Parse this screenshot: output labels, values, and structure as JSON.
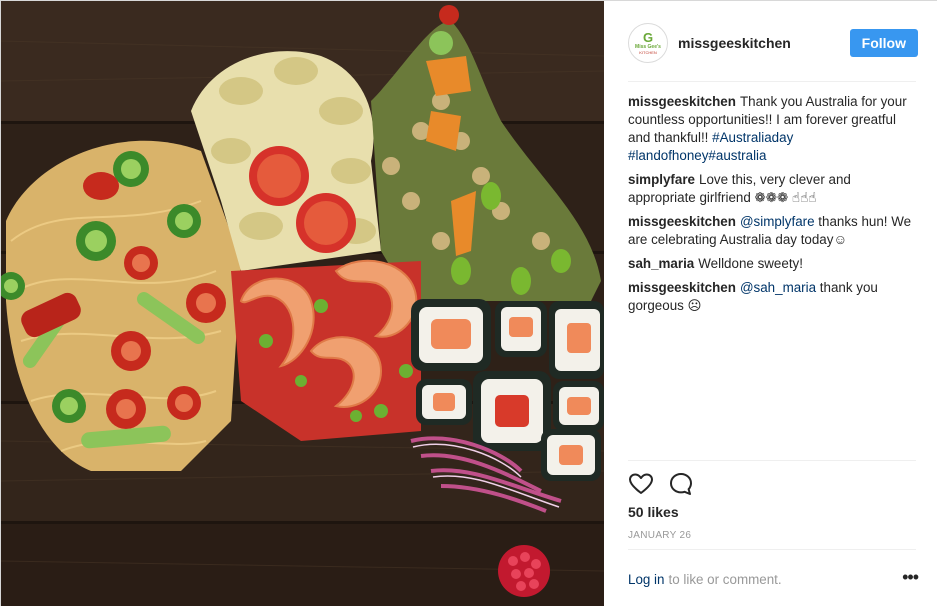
{
  "post": {
    "username": "missgeeskitchen",
    "follow_label": "Follow",
    "avatar": {
      "letter": "G",
      "line1": "Miss Gee's",
      "line2": "KITCHEN"
    },
    "comments": [
      {
        "user": "missgeeskitchen",
        "text": "Thank you Australia for your countless opportunities!! I am forever greatful and thankful!!",
        "links": [
          "#Australiaday",
          "#landofhoney",
          "#australia"
        ]
      },
      {
        "user": "simplyfare",
        "text": "Love this, very clever and appropriate girlfriend ❁❁❁ ☝☝☝"
      },
      {
        "user": "missgeeskitchen",
        "mention": "@simplyfare",
        "text": "thanks hun! We are celebrating Australia day today☺"
      },
      {
        "user": "sah_maria",
        "text": "Welldone sweety!"
      },
      {
        "user": "missgeeskitchen",
        "mention": "@sah_maria",
        "text": "thank you gorgeous ☹"
      }
    ],
    "likes": "50 likes",
    "date": "JANUARY 26",
    "footer": {
      "login_label": "Log in",
      "rest": "to like or comment.",
      "more_label": "•••"
    }
  },
  "icons": {
    "like": "heart-icon",
    "comment": "comment-bubble-icon",
    "more": "more-options-icon"
  },
  "colors": {
    "follow_button": "#3897f0",
    "link": "#003569",
    "muted": "#999999"
  }
}
